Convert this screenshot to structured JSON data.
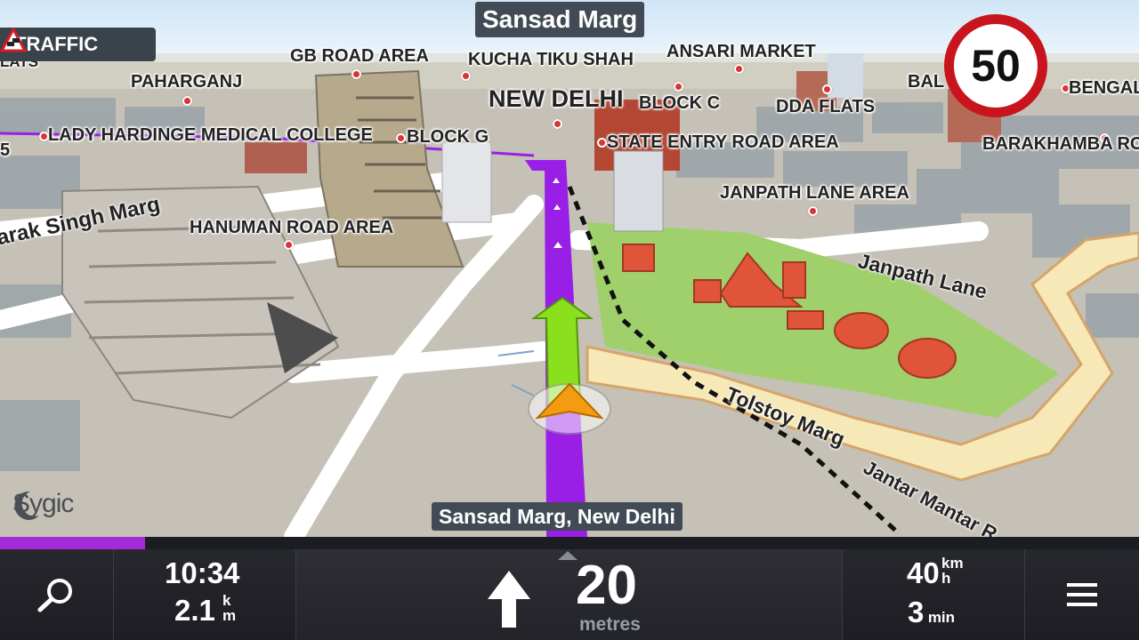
{
  "map": {
    "street_top": "Sansad Marg",
    "street_bottom": "Sansad Marg, New Delhi",
    "traffic_label": "TRAFFIC",
    "speed_limit": "50",
    "brand": "Sygic",
    "pois": {
      "gb_road": "GB ROAD AREA",
      "kucha": "KUCHA TIKU SHAH",
      "ansari": "ANSARI MARKET",
      "paharganj": "PAHARGANJ",
      "new_delhi": "NEW DELHI",
      "block_c": "BLOCK C",
      "dda": "DDA FLATS",
      "lady": "LADY HARDINGE MEDICAL COLLEGE",
      "block_g": "BLOCK G",
      "state": "STATE ENTRY ROAD AREA",
      "barakhamba": "BARAKHAMBA RO",
      "bengal": "BENGAL",
      "bal": "BAL",
      "janpath_area": "JANPATH LANE AREA",
      "hanuman": "HANUMAN ROAD AREA",
      "lats": "LATS",
      "left_five": "5"
    },
    "roads": {
      "kharak": "arak Singh Marg",
      "janpath": "Janpath Lane",
      "tolstoy": "Tolstoy Marg",
      "jantar": "Jantar Mantar R"
    }
  },
  "progress": {
    "fraction": 0.127
  },
  "bottom_bar": {
    "search_icon": "search-icon",
    "time": "10:34",
    "distance_value": "2.1",
    "distance_unit_top": "k",
    "distance_unit_bottom": "m",
    "turn_icon": "arrow-up-icon",
    "turn_distance": "20",
    "turn_unit": "metres",
    "speed_value": "40",
    "speed_unit_top": "km",
    "speed_unit_bottom": "h",
    "eta_value": "3",
    "eta_unit": "min",
    "menu_icon": "hamburger-menu-icon"
  },
  "colors": {
    "route": "#9a1fe6",
    "next_turn_arrow": "#8be01e",
    "position_arrow": "#f39c12",
    "speed_sign_border": "#c8141c",
    "progress": "#a52ad9"
  }
}
